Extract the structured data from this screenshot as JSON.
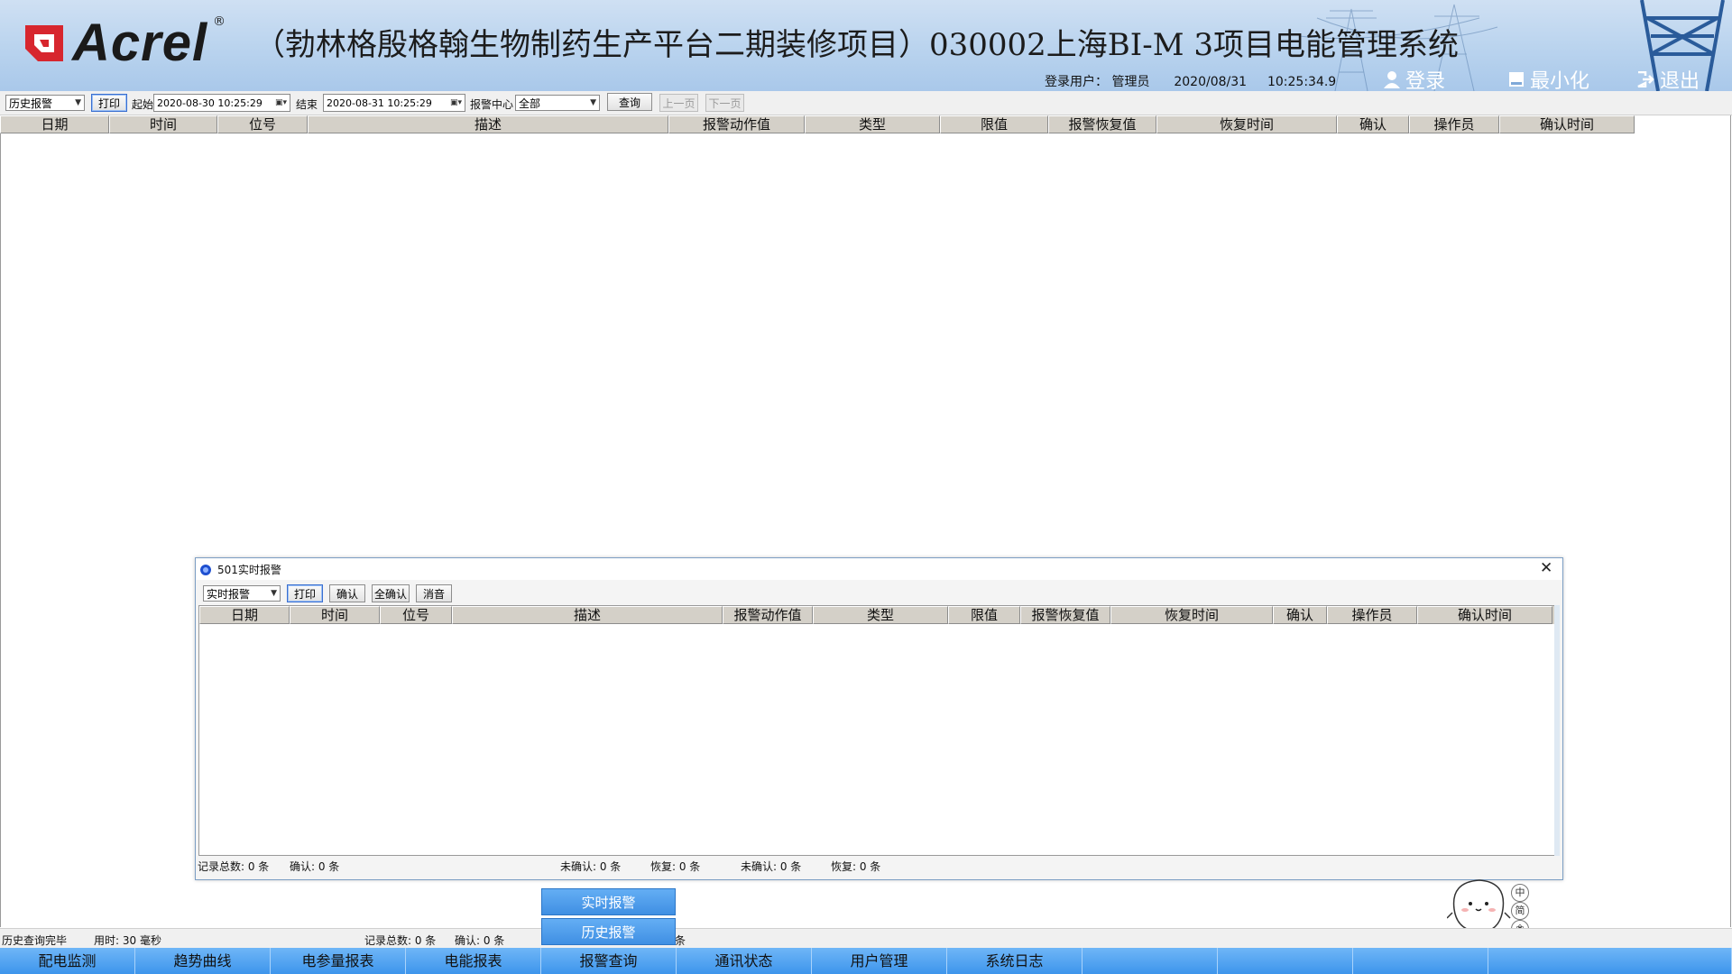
{
  "header": {
    "logo_text": "Acrel",
    "logo_reg": "®",
    "title": "（勃林格殷格翰生物制药生产平台二期装修项目）030002上海BI-M 3项目电能管理系统",
    "login_label": "登录用户：",
    "login_user": "管理员",
    "date": "2020/08/31",
    "time": "10:25:34.9",
    "login_btn": "登录",
    "minimize_btn": "最小化",
    "exit_btn": "退出"
  },
  "toolbar": {
    "mode_select": "历史报警",
    "print_btn": "打印",
    "start_label": "起始",
    "start_value": "2020-08-30  10:25:29",
    "end_label": "结束",
    "end_value": "2020-08-31  10:25:29",
    "center_label": "报警中心",
    "center_value": "全部",
    "query_btn": "查询",
    "prev_btn": "上一页",
    "next_btn": "下一页"
  },
  "main_table": {
    "columns": [
      "日期",
      "时间",
      "位号",
      "描述",
      "报警动作值",
      "类型",
      "限值",
      "报警恢复值",
      "恢复时间",
      "确认",
      "操作员",
      "确认时间"
    ]
  },
  "popup": {
    "title": "501实时报警",
    "close": "✕",
    "mode_select": "实时报警",
    "print_btn": "打印",
    "confirm_btn": "确认",
    "confirm_all_btn": "全确认",
    "mute_btn": "消音",
    "columns": [
      "日期",
      "时间",
      "位号",
      "描述",
      "报警动作值",
      "类型",
      "限值",
      "报警恢复值",
      "恢复时间",
      "确认",
      "操作员",
      "确认时间"
    ],
    "status": {
      "total": "记录总数: 0 条",
      "confirmed": "确认: 0 条",
      "unconfirmed_1": "未确认: 0 条",
      "restored_1": "恢复: 0 条",
      "unconfirmed_2": "未确认: 0 条",
      "restored_2": "恢复: 0 条"
    }
  },
  "statusbar": {
    "query_done": "历史查询完毕",
    "elapsed": "用时: 30 毫秒",
    "total": "记录总数: 0 条",
    "confirmed": "确认: 0 条",
    "tail": "条"
  },
  "submenu": {
    "realtime": "实时报警",
    "history": "历史报警"
  },
  "navbar": {
    "items": [
      "配电监测",
      "趋势曲线",
      "电参量报表",
      "电能报表",
      "报警查询",
      "通讯状态",
      "用户管理",
      "系统日志",
      "",
      "",
      "",
      ""
    ]
  },
  "ime": {
    "lang": "中",
    "mode": "简",
    "icon": "paw-icon"
  },
  "colors": {
    "header_bg": "#b9d3ee",
    "nav_bg": "#3d95ec",
    "table_header_bg": "#d4d0c8",
    "logo_red": "#d7262e"
  }
}
